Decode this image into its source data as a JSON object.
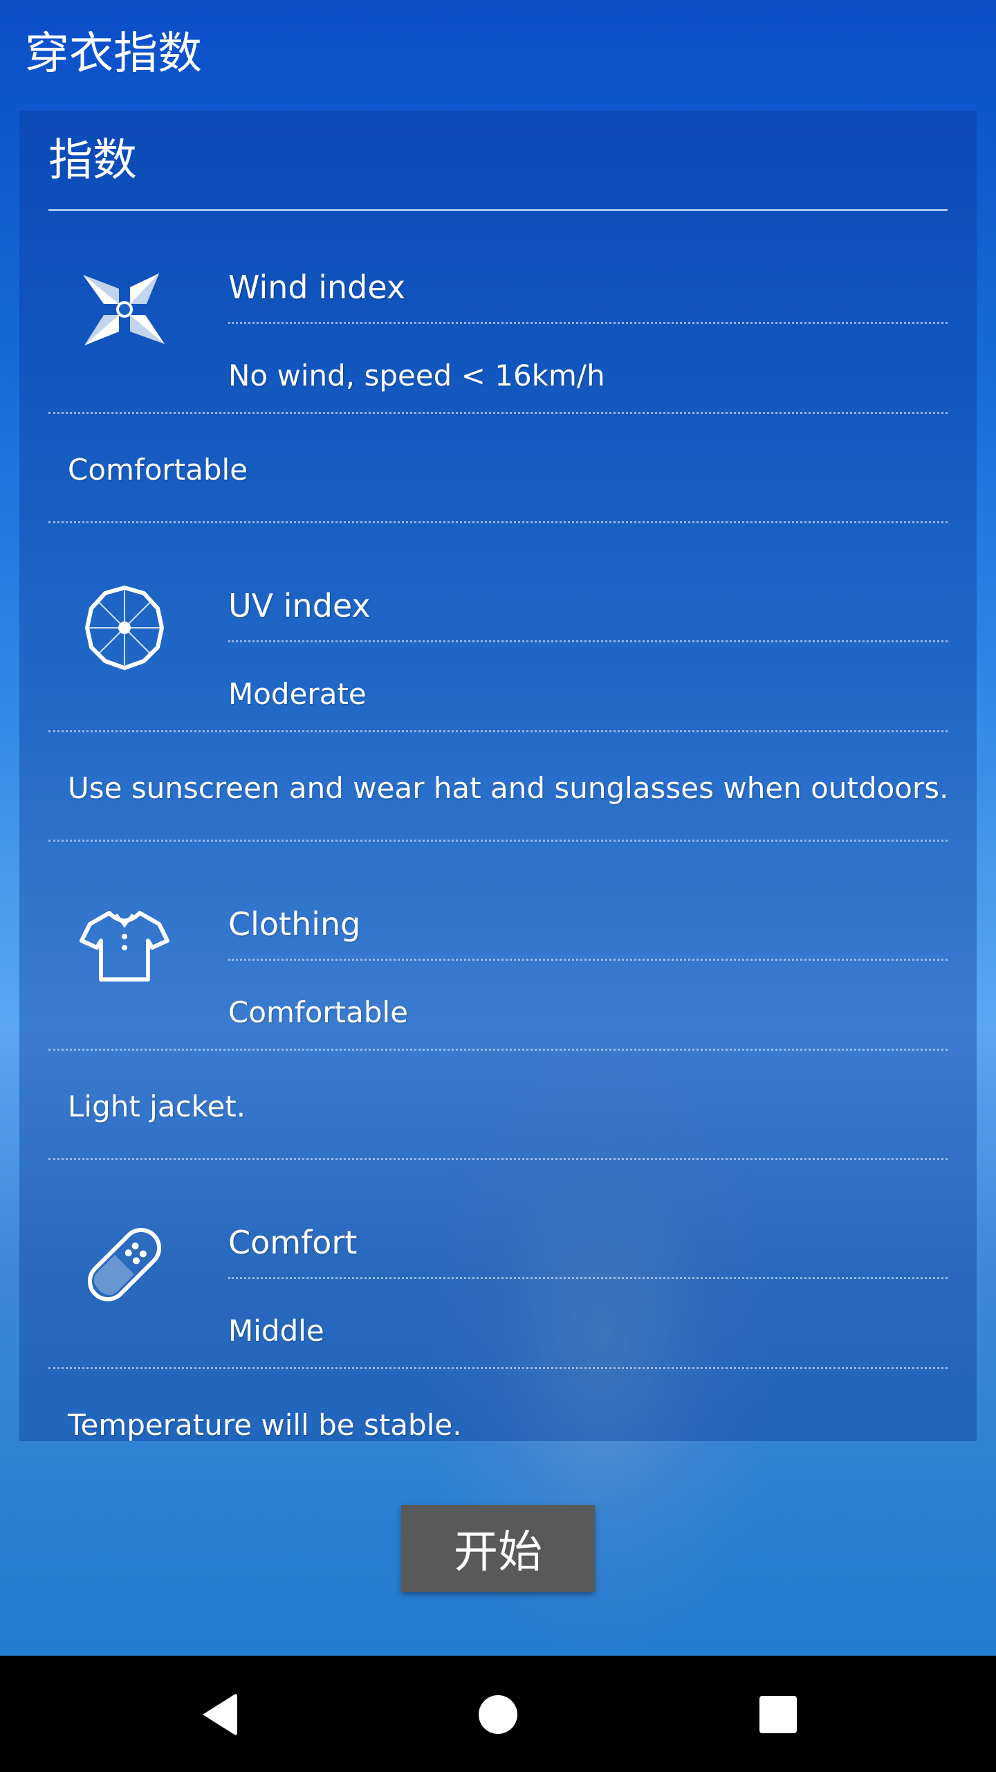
{
  "app": {
    "title": "穿衣指数"
  },
  "card": {
    "header": "指数",
    "items": [
      {
        "icon": "pinwheel-icon",
        "title": "Wind index",
        "value": "No wind, speed < 16km/h",
        "description": "Comfortable"
      },
      {
        "icon": "umbrella-icon",
        "title": "UV index",
        "value": "Moderate",
        "description": "Use sunscreen and wear hat and sunglasses when outdoors."
      },
      {
        "icon": "tshirt-icon",
        "title": "Clothing",
        "value": "Comfortable",
        "description": "Light jacket."
      },
      {
        "icon": "bandage-icon",
        "title": "Comfort",
        "value": "Middle",
        "description": "Temperature will be stable."
      }
    ]
  },
  "actions": {
    "start_label": "开始"
  },
  "nav": {
    "back": "back-icon",
    "home": "home-icon",
    "recents": "recents-icon"
  },
  "colors": {
    "background_top": "#0a4ec8",
    "background_mid": "#5aa6f3",
    "button_bg": "#595959",
    "nav_bg": "#000000"
  }
}
